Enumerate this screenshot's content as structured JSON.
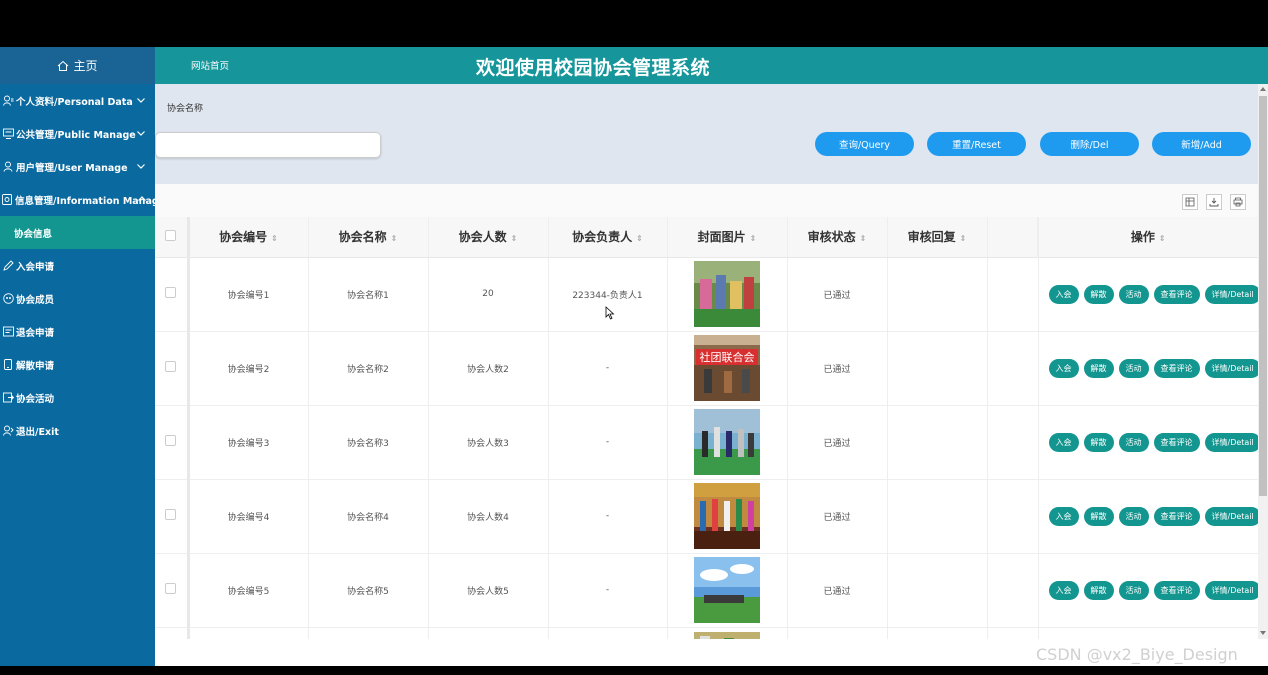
{
  "sidebar": {
    "home": "主页",
    "items": [
      {
        "label": "个人资料/Personal Data"
      },
      {
        "label": "公共管理/Public Manage"
      },
      {
        "label": "用户管理/User Manage"
      },
      {
        "label": "信息管理/Information Manage"
      },
      {
        "label": "协会信息"
      },
      {
        "label": "入会申请"
      },
      {
        "label": "协会成员"
      },
      {
        "label": "退会申请"
      },
      {
        "label": "解散申请"
      },
      {
        "label": "协会活动"
      },
      {
        "label": "退出/Exit"
      }
    ]
  },
  "header": {
    "site_home": "网站首页",
    "title": "欢迎使用校园协会管理系统"
  },
  "search": {
    "label": "协会名称",
    "placeholder": "",
    "buttons": {
      "query": "查询/Query",
      "reset": "重置/Reset",
      "del": "删除/Del",
      "add": "新增/Add"
    }
  },
  "table": {
    "headers": {
      "code": "协会编号",
      "name": "协会名称",
      "count": "协会人数",
      "leader": "协会负责人",
      "cover": "封面图片",
      "status": "审核状态",
      "reply": "审核回复",
      "ops": "操作"
    },
    "rows": [
      {
        "code": "协会编号1",
        "name": "协会名称1",
        "count": "20",
        "leader": "223344-负责人1",
        "status": "已通过",
        "reply": ""
      },
      {
        "code": "协会编号2",
        "name": "协会名称2",
        "count": "协会人数2",
        "leader": "-",
        "status": "已通过",
        "reply": ""
      },
      {
        "code": "协会编号3",
        "name": "协会名称3",
        "count": "协会人数3",
        "leader": "-",
        "status": "已通过",
        "reply": ""
      },
      {
        "code": "协会编号4",
        "name": "协会名称4",
        "count": "协会人数4",
        "leader": "-",
        "status": "已通过",
        "reply": ""
      },
      {
        "code": "协会编号5",
        "name": "协会名称5",
        "count": "协会人数5",
        "leader": "-",
        "status": "已通过",
        "reply": ""
      }
    ],
    "cover_text_row2": "社团联合会",
    "ops": {
      "join": "入会",
      "dissolve": "解散",
      "activity": "活动",
      "comments": "查看评论",
      "detail": "详情/Detail"
    }
  },
  "watermark": "CSDN @vx2_Biye_Design",
  "colors": {
    "sidebar": "#0a6aa0",
    "header": "#16969a",
    "active": "#12968f",
    "primary_button": "#1e9bef"
  }
}
